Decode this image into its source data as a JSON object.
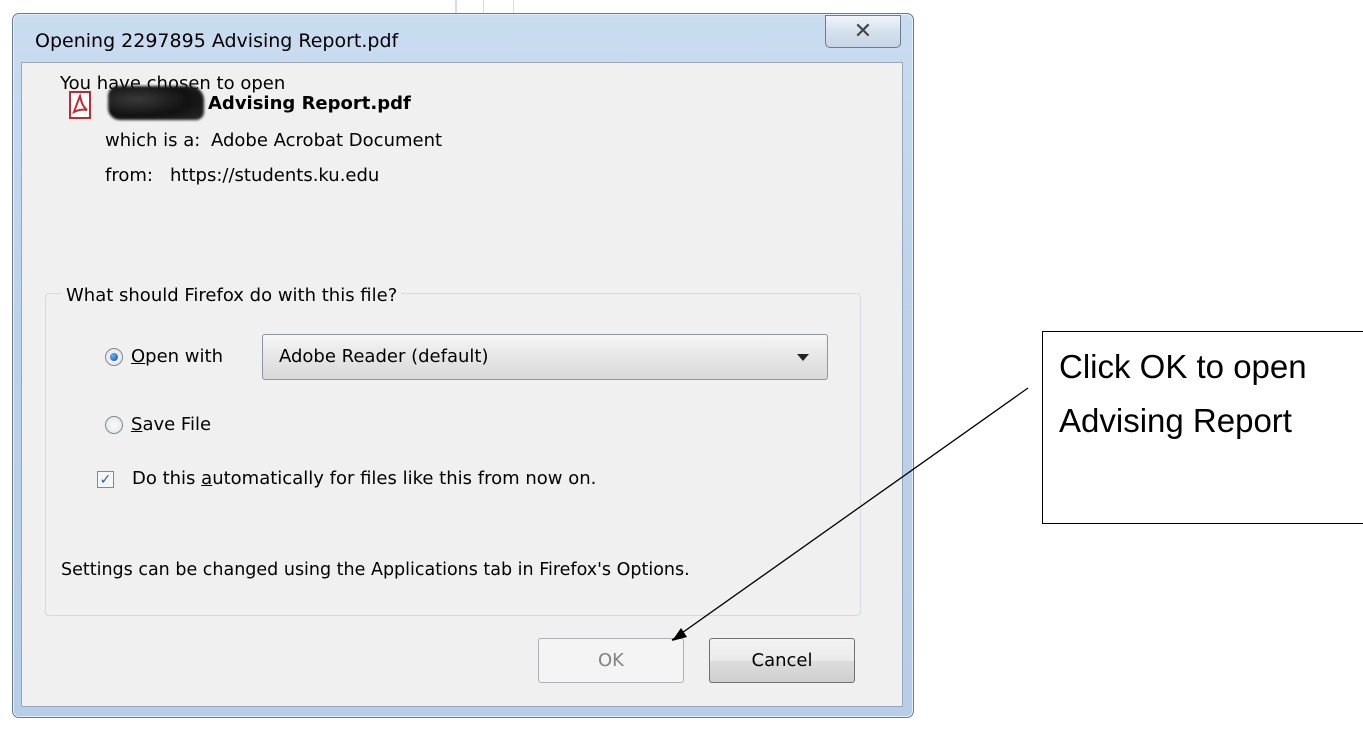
{
  "dialog": {
    "title": "Opening 2297895 Advising Report.pdf",
    "close_glyph": "✕",
    "intro": "You have chosen to open",
    "file_name": "Advising Report.pdf",
    "type_label": "which is a:",
    "type_value": "Adobe Acrobat Document",
    "from_label": "from:",
    "from_value": "https://students.ku.edu",
    "group_title": "What should Firefox do with this file?",
    "open_with": {
      "label_underline": "O",
      "label_rest": "pen with",
      "selected": true,
      "app": "Adobe Reader  (default)"
    },
    "save_file": {
      "label_underline": "S",
      "label_rest": "ave File",
      "selected": false
    },
    "auto_checkbox": {
      "label_pre": "Do this ",
      "label_underline": "a",
      "label_post": "utomatically for files like this from now on.",
      "checked": true
    },
    "settings_note": "Settings can be changed using the Applications tab in Firefox's Options.",
    "ok_label": "OK",
    "cancel_label": "Cancel"
  },
  "callout": {
    "line1": "Click OK to open",
    "line2": "Advising Report"
  },
  "icons": [
    "pdf-file-icon",
    "close-icon",
    "dropdown-arrow-icon",
    "checkmark-icon"
  ],
  "colors": {
    "dialog_frame": "#bcd2ea",
    "client_bg": "#f0f0f0",
    "radio_dot": "#1f5fb4",
    "pdf_red": "#c8282d"
  }
}
